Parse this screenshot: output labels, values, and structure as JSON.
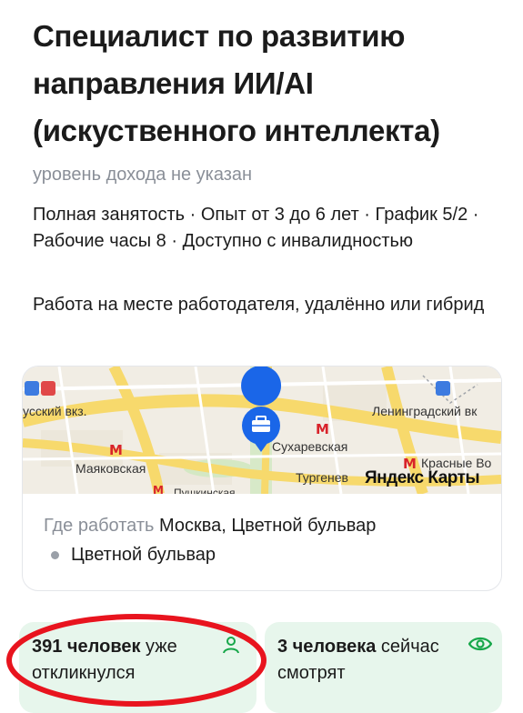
{
  "vacancy": {
    "title": "Специалист по развитию\nнаправления ИИ/AI\n(искуственного интеллекта)",
    "salary": "уровень дохода не указан",
    "conditions": "Полная занятость · Опыт от 3 до 6 лет · График 5/2 · Рабочие часы 8 · Доступно с инвалидностью",
    "work_format": "Работа на месте работодателя, удалённо или гибрид"
  },
  "map": {
    "labels": {
      "station_left": "усский вкз.",
      "station_right": "Ленинградский вк",
      "metro_1": "Сухаревская",
      "metro_2": "Маяковская",
      "metro_3": "Тургенев",
      "metro_4": "Красные Во",
      "metro_5": "Пушкинская",
      "brand": "Яндекс Карты"
    },
    "colors": {
      "metro": "#d8232a",
      "pin": "#1a66e8",
      "road": "#f7d96c"
    }
  },
  "location": {
    "prefix": "Где работать",
    "address": "Москва, Цветной бульвар",
    "metro_station": "Цветной бульвар"
  },
  "stats": {
    "responses": {
      "count": "391 человек",
      "suffix": "уже откликнулся",
      "icon": "person-icon"
    },
    "viewing": {
      "count": "3 человека",
      "suffix": "сейчас смотрят",
      "icon": "eye-icon"
    }
  },
  "colors": {
    "stat_bg": "#e7f6ec",
    "accent_green": "#17a74a",
    "highlight_red": "#e8141e",
    "muted": "#8a8f98"
  }
}
